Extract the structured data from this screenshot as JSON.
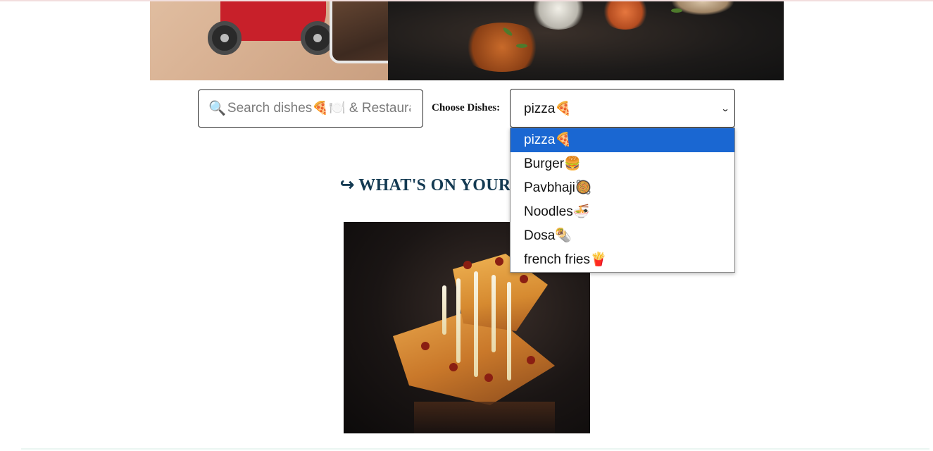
{
  "search": {
    "placeholder": "Search dishes🍕🍽️ & Restaura",
    "icon": "magnifier-icon"
  },
  "dish_select": {
    "label": "Choose Dishes:",
    "selected_value": "pizza🍕",
    "options": [
      {
        "label": "pizza🍕",
        "selected": true
      },
      {
        "label": "Burger🍔",
        "selected": false
      },
      {
        "label": "Pavbhaji🥘",
        "selected": false
      },
      {
        "label": "Noodles🍜",
        "selected": false
      },
      {
        "label": "Dosa🌯",
        "selected": false
      },
      {
        "label": "french fries🍟",
        "selected": false
      }
    ],
    "highlight_color": "#1a67d2"
  },
  "section": {
    "heading": "↪ WHAT'S ON YOUR",
    "heading_color": "#143a52"
  },
  "dish_image": {
    "subject": "pizza"
  }
}
